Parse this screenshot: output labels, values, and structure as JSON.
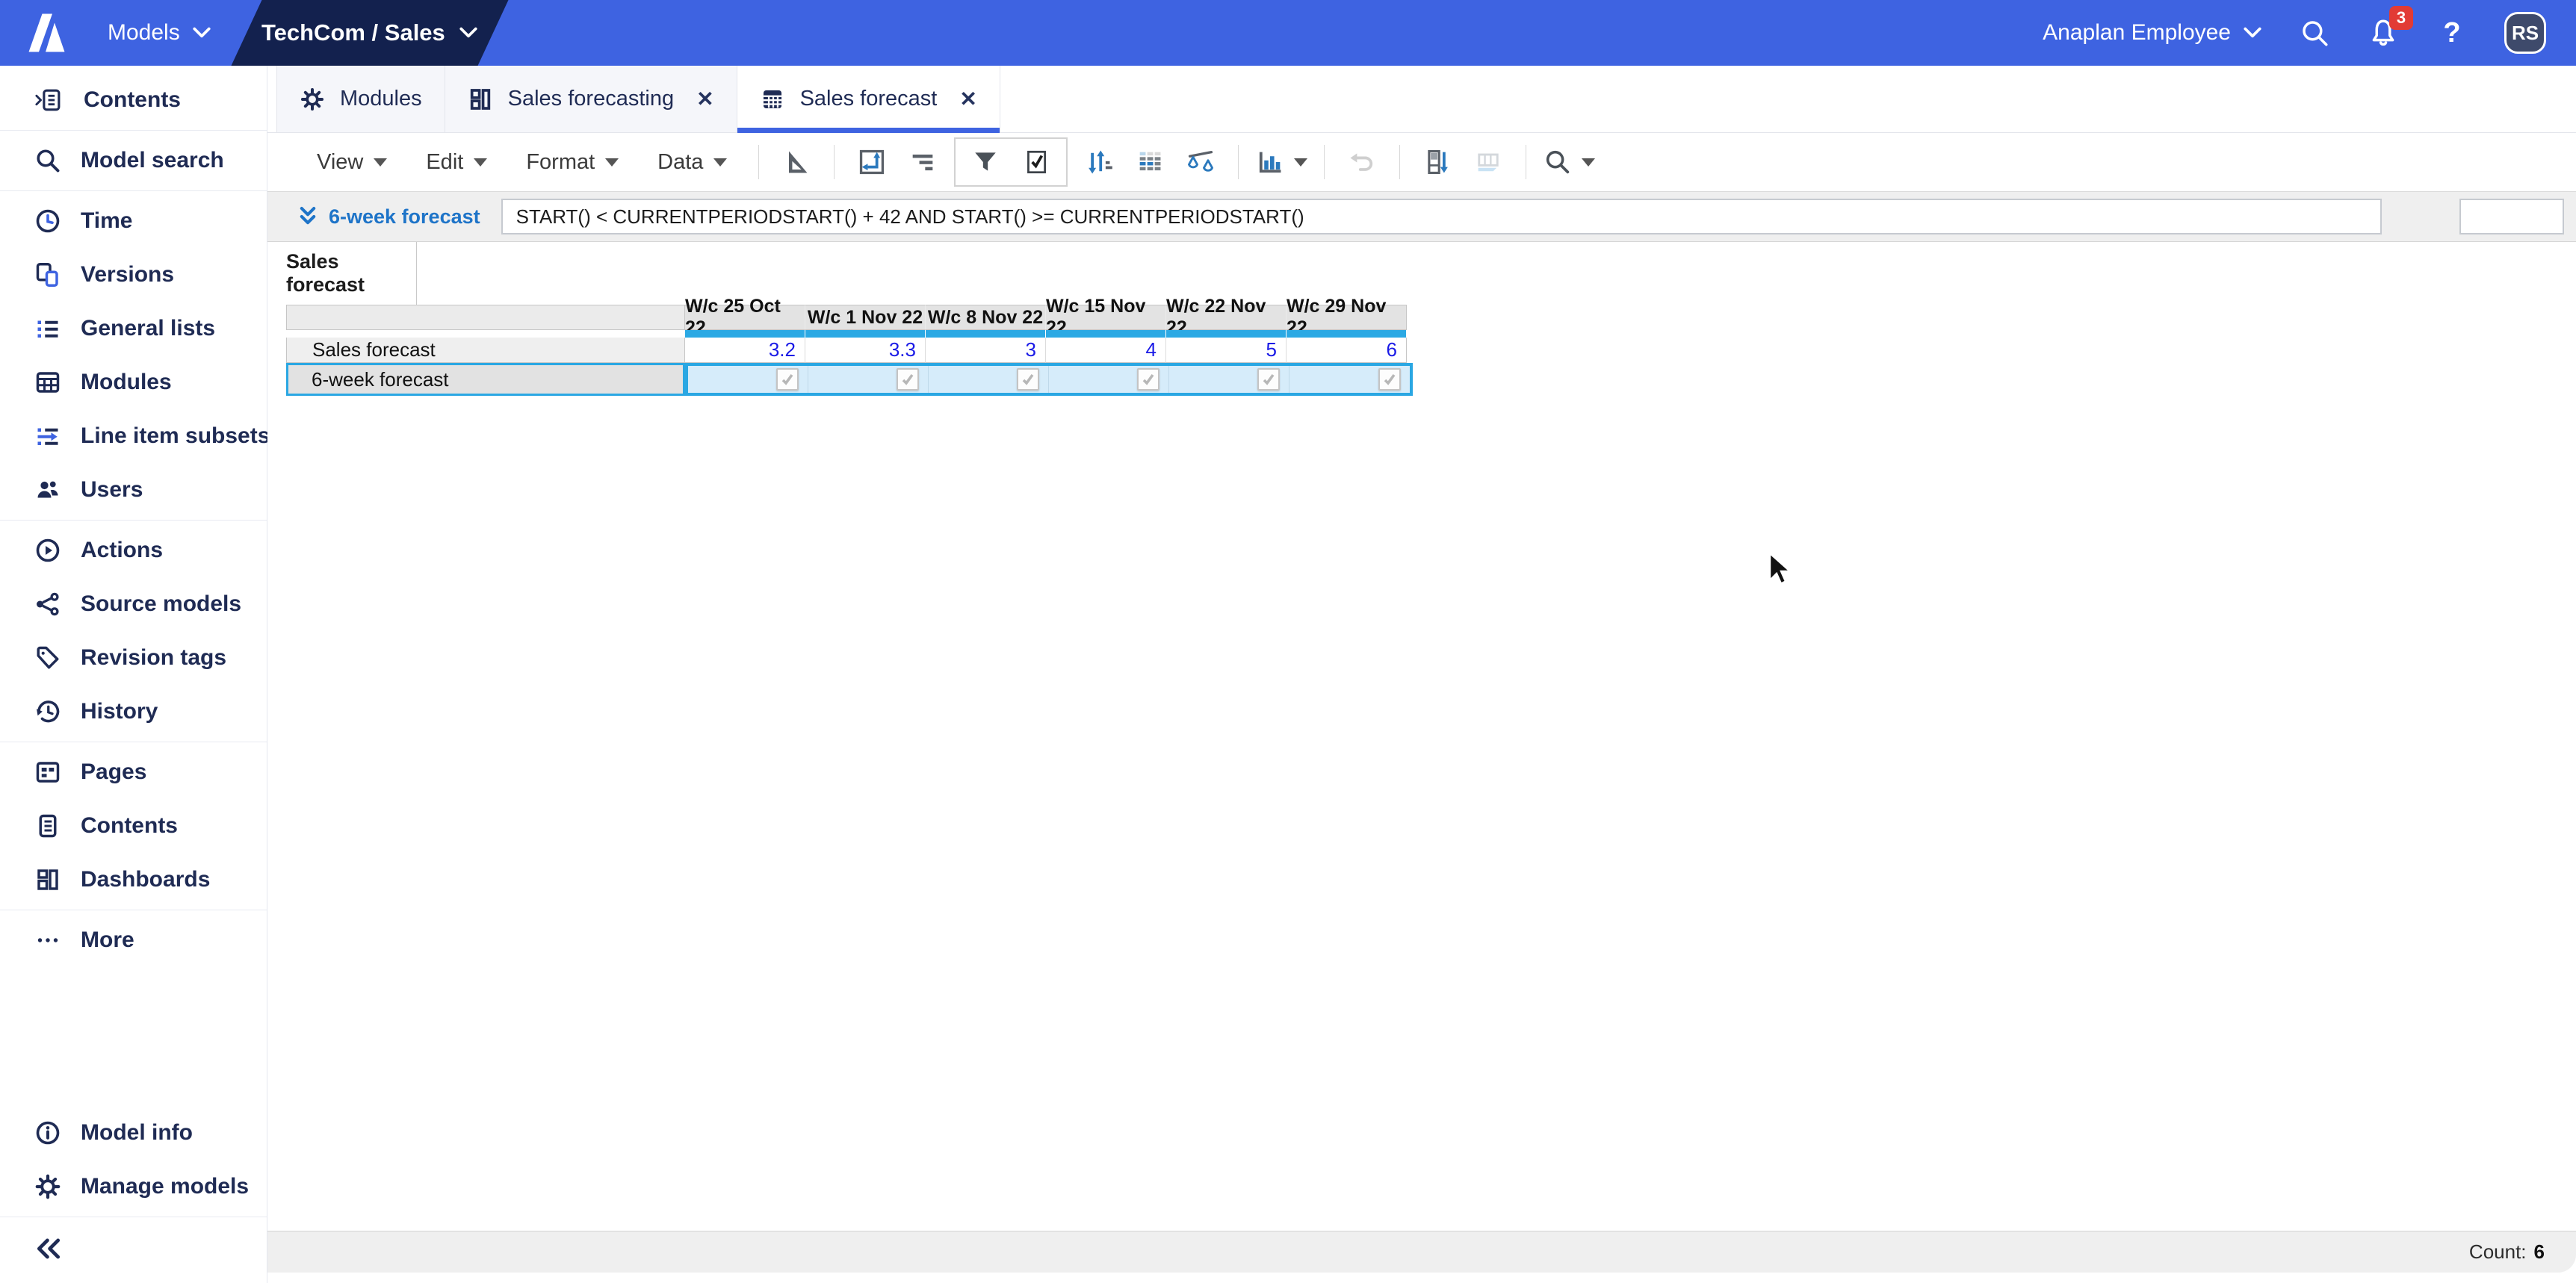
{
  "topbar": {
    "models_label": "Models",
    "model_name": "TechCom / Sales",
    "user_label": "Anaplan Employee",
    "notification_count": "3",
    "help_glyph": "?",
    "avatar_initials": "RS"
  },
  "tabs": [
    {
      "label": "Modules"
    },
    {
      "label": "Sales forecasting"
    },
    {
      "label": "Sales forecast"
    }
  ],
  "toolbar": {
    "menus": [
      {
        "label": "View"
      },
      {
        "label": "Edit"
      },
      {
        "label": "Format"
      },
      {
        "label": "Data"
      }
    ]
  },
  "formula_bar": {
    "line_item": "6-week forecast",
    "formula": "START() < CURRENTPERIODSTART() + 42 AND START() >= CURRENTPERIODSTART()"
  },
  "view_tab_label": "Sales forecast",
  "grid": {
    "columns": [
      "W/c 25 Oct 22",
      "W/c 1 Nov 22",
      "W/c 8 Nov 22",
      "W/c 15 Nov 22",
      "W/c 22 Nov 22",
      "W/c 29 Nov 22"
    ],
    "rows": [
      {
        "label": "Sales forecast",
        "type": "number",
        "values": [
          "3.2",
          "3.3",
          "3",
          "4",
          "5",
          "6"
        ]
      },
      {
        "label": "6-week forecast",
        "type": "boolean",
        "selected": true,
        "values": [
          true,
          true,
          true,
          true,
          true,
          true
        ]
      }
    ]
  },
  "sidebar": {
    "items": [
      {
        "label": "Contents"
      },
      {
        "label": "Model search"
      },
      {
        "label": "Time"
      },
      {
        "label": "Versions"
      },
      {
        "label": "General lists"
      },
      {
        "label": "Modules"
      },
      {
        "label": "Line item subsets"
      },
      {
        "label": "Users"
      },
      {
        "label": "Actions"
      },
      {
        "label": "Source models"
      },
      {
        "label": "Revision tags"
      },
      {
        "label": "History"
      },
      {
        "label": "Pages"
      },
      {
        "label": "Contents"
      },
      {
        "label": "Dashboards"
      },
      {
        "label": "More"
      },
      {
        "label": "Model info"
      },
      {
        "label": "Manage models"
      }
    ]
  },
  "status_bar": {
    "count_label": "Count:",
    "count_value": "6"
  },
  "colors": {
    "topbar_blue": "#3E63E1",
    "navy": "#1F2B54",
    "model_tab_navy": "#13214E",
    "selection_blue": "#2AA7E3",
    "value_blue": "#1A1AE6",
    "badge_red": "#E23B35",
    "formula_label_blue": "#1E74C8"
  }
}
